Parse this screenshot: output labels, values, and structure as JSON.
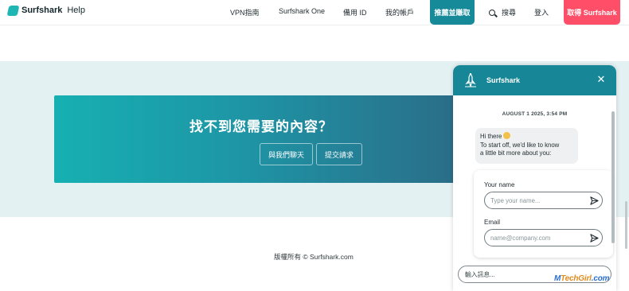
{
  "header": {
    "logo_text": "Surfshark",
    "logo_suffix": "Help",
    "nav": {
      "vpn_guide": "VPN指南",
      "surfshark_one": "Surfshark One",
      "alt_id": "備用 ID",
      "my_account": "我的帳戶",
      "referral": "推薦並賺取",
      "search": "搜尋",
      "login": "登入",
      "get_surfshark": "取得 Surfshark"
    },
    "colors": {
      "referral_bg": "#178a9a",
      "cta_bg": "#ff4e68"
    }
  },
  "help": {
    "title": "找不到您需要的內容？",
    "chat_button": "與我們聊天",
    "submit_button": "提交請求"
  },
  "footer": {
    "copyright": "版權所有 © Surfshark.com"
  },
  "chat": {
    "agent_name": "Surfshark",
    "date": "AUGUST 1 2025, 3:54 PM",
    "greeting_line1": "Hi there",
    "greeting_line2": "To start off, we'd like to know",
    "greeting_line3": "a little bit more about you:",
    "name_label": "Your name",
    "name_placeholder": "Type your name...",
    "email_label": "Email",
    "email_placeholder": "name@company.com",
    "message_placeholder": "輸入訊息...",
    "icons": {
      "avatar": "rocket-icon",
      "close": "close-icon",
      "send": "send-icon"
    }
  },
  "watermark": {
    "part1": "M",
    "part2": "TechGirl",
    "part3": ".com"
  }
}
